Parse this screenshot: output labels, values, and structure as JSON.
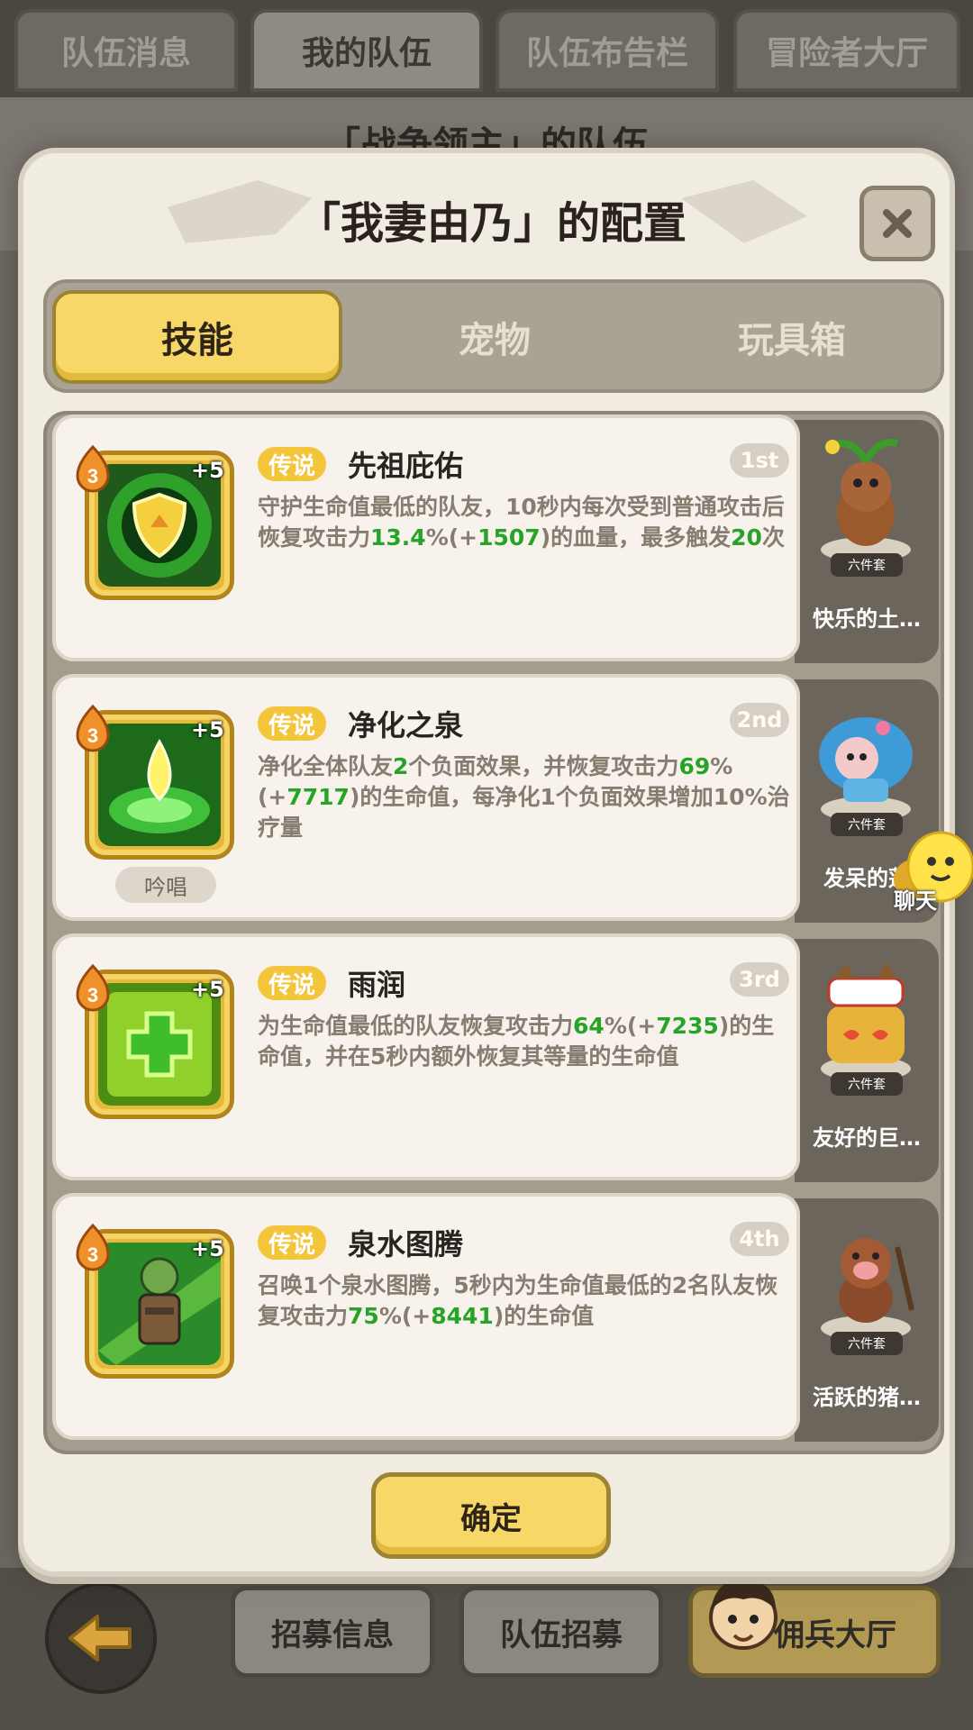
{
  "top_tabs": [
    "队伍消息",
    "我的队伍",
    "队伍布告栏",
    "冒险者大厅"
  ],
  "background_title": "「战争领主」的队伍",
  "modal": {
    "title": "「我妻由乃」的配置",
    "tabs": [
      "技能",
      "宠物",
      "玩具箱"
    ],
    "skills": [
      {
        "level": "3",
        "plus": "+5",
        "rarity": "传说",
        "name": "先祖庇佑",
        "rank": "1st",
        "desc": [
          "守护生命值最低的队友，10秒内每次受到普通攻击后恢复攻击力",
          "13.4",
          "%(+",
          "1507",
          ")的血量，最多触发",
          "20",
          "次"
        ],
        "chant": "",
        "pet_label": "快乐的土…",
        "set_badge": "六件套"
      },
      {
        "level": "3",
        "plus": "+5",
        "rarity": "传说",
        "name": "净化之泉",
        "rank": "2nd",
        "desc": [
          "净化全体队友",
          "2",
          "个负面效果，并恢复攻击力",
          "69",
          "%(+",
          "7717",
          ")的生命值，每净化1个负面效果增加10%治疗量"
        ],
        "chant": "吟唱",
        "pet_label": "发呆的蓬",
        "set_badge": "六件套"
      },
      {
        "level": "3",
        "plus": "+5",
        "rarity": "传说",
        "name": "雨润",
        "rank": "3rd",
        "desc": [
          "为生命值最低的队友恢复攻击力",
          "64",
          "%(+",
          "7235",
          ")的生命值，并在5秒内额外恢复其等量的生命值"
        ],
        "chant": "",
        "pet_label": "友好的巨…",
        "set_badge": "六件套"
      },
      {
        "level": "3",
        "plus": "+5",
        "rarity": "传说",
        "name": "泉水图腾",
        "rank": "4th",
        "desc": [
          "召唤1个泉水图腾，5秒内为生命值最低的2名队友恢复攻击力",
          "75",
          "%(+",
          "8441",
          ")的生命值"
        ],
        "chant": "",
        "pet_label": "活跃的猪…",
        "set_badge": "六件套"
      }
    ],
    "confirm": "确定"
  },
  "chat_label": "聊天",
  "bottom": {
    "recruit_info": "招募信息",
    "team_recruit": "队伍招募",
    "mercenary_hall": "佣兵大厅"
  }
}
